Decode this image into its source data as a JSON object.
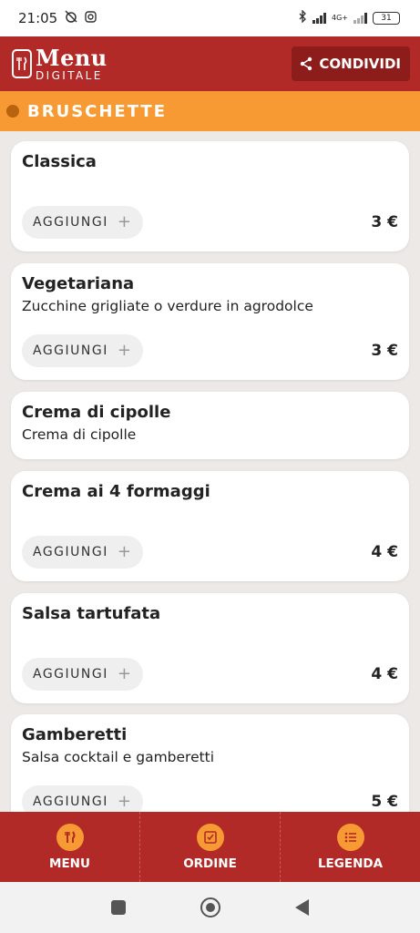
{
  "status_bar": {
    "time": "21:05",
    "network": "4G+",
    "battery": "31"
  },
  "header": {
    "logo_main": "Menu",
    "logo_sub": "DIGITALE",
    "share_label": "CONDIVIDI"
  },
  "section": {
    "title": "BRUSCHETTE"
  },
  "items": [
    {
      "name": "Classica",
      "description": "",
      "add_label": "AGGIUNGI",
      "price": "3 €"
    },
    {
      "name": "Vegetariana",
      "description": "Zucchine grigliate o verdure in agrodolce",
      "add_label": "AGGIUNGI",
      "price": "3 €"
    },
    {
      "name": "Crema di cipolle",
      "description": "Crema di cipolle"
    },
    {
      "name": "Crema ai 4 formaggi",
      "description": "",
      "add_label": "AGGIUNGI",
      "price": "4 €"
    },
    {
      "name": "Salsa tartufata",
      "description": "",
      "add_label": "AGGIUNGI",
      "price": "4 €"
    },
    {
      "name": "Gamberetti",
      "description": "Salsa cocktail e gamberetti",
      "add_label": "AGGIUNGI",
      "price": "5 €"
    }
  ],
  "bottom_nav": [
    {
      "label": "MENU",
      "icon": "cutlery-icon"
    },
    {
      "label": "ORDINE",
      "icon": "order-list-icon"
    },
    {
      "label": "LEGENDA",
      "icon": "legend-list-icon"
    }
  ],
  "colors": {
    "primary": "#b22a27",
    "accent": "#f79a34",
    "background": "#ece9e6"
  }
}
